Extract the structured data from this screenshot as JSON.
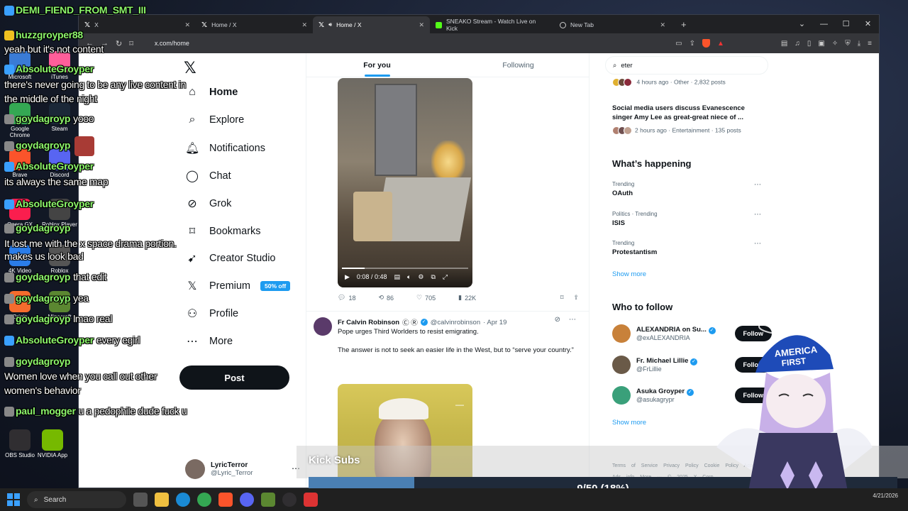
{
  "desktop": {
    "icons": [
      {
        "label": "Microsoft",
        "color": "#3a7bd5"
      },
      {
        "label": "iTunes",
        "color": "#ff5e9a"
      },
      {
        "label": "Google Chrome",
        "color": "#34a853"
      },
      {
        "label": "Steam",
        "color": "#1b2838"
      },
      {
        "label": "Brave",
        "color": "#fb542b"
      },
      {
        "label": "Discord",
        "color": "#5865f2"
      },
      {
        "label": "Opera GX",
        "color": "#fa1e4e"
      },
      {
        "label": "Roblox Player",
        "color": "#444"
      },
      {
        "label": "4K Video",
        "color": "#2b7de9"
      },
      {
        "label": "Roblox",
        "color": "#555"
      },
      {
        "label": "Origin",
        "color": "#f56c2d"
      },
      {
        "label": "Minecraft",
        "color": "#5b8731"
      },
      {
        "label": "OBS Studio",
        "color": "#302e31"
      },
      {
        "label": "NVIDIA App",
        "color": "#76b900"
      }
    ]
  },
  "browser": {
    "tabs": [
      {
        "label": "X",
        "active": false
      },
      {
        "label": "Home / X",
        "active": false
      },
      {
        "label": "Home / X",
        "active": true
      },
      {
        "label": "SNEAKO Stream - Watch Live on Kick",
        "active": false
      },
      {
        "label": "New Tab",
        "active": false
      }
    ],
    "url": "x.com/home"
  },
  "x": {
    "nav": [
      {
        "label": "Home",
        "icon": "home-icon",
        "glyph": "⌂",
        "bold": true
      },
      {
        "label": "Explore",
        "icon": "search-icon",
        "glyph": "⌕"
      },
      {
        "label": "Notifications",
        "icon": "bell-icon",
        "glyph": "🔔︎"
      },
      {
        "label": "Chat",
        "icon": "chat-icon",
        "glyph": "◯"
      },
      {
        "label": "Grok",
        "icon": "grok-icon",
        "glyph": "⊘"
      },
      {
        "label": "Bookmarks",
        "icon": "bookmark-icon",
        "glyph": "⌑"
      },
      {
        "label": "Creator Studio",
        "icon": "rocket-icon",
        "glyph": "➹"
      },
      {
        "label": "Premium",
        "icon": "x-premium-icon",
        "glyph": "𝕏",
        "badge": "50% off"
      },
      {
        "label": "Profile",
        "icon": "profile-icon",
        "glyph": "⚇"
      },
      {
        "label": "More",
        "icon": "more-icon",
        "glyph": "⋯"
      }
    ],
    "post_label": "Post",
    "me": {
      "name": "LyricTerror",
      "handle": "@Lyric_Terror"
    },
    "feed_tabs": [
      "For you",
      "Following"
    ],
    "tweet1": {
      "video_time": "0:08 / 0:48",
      "progress": 0.18,
      "replies": "18",
      "reposts": "86",
      "likes": "705",
      "views": "22K"
    },
    "tweet2": {
      "name": "Fr Calvin Robinson",
      "name_suffix": "Ⓒ Ⓡ",
      "handle": "@calvinrobinson",
      "date": "· Apr 19",
      "line1": "Pope urges Third Worlders to resist emigrating.",
      "line2": "The answer is not to seek an easier life in the West, but to “serve your country.”"
    },
    "search_value": "eter",
    "news": [
      {
        "meta": "4 hours ago · Other · 2,832 posts"
      },
      {
        "title": "Social media users discuss Evanescence singer Amy Lee as great-great niece of ...",
        "meta": "2 hours ago · Entertainment · 135 posts"
      }
    ],
    "whats_happening": "What’s happening",
    "trends": [
      {
        "ctx": "Trending",
        "name": "OAuth"
      },
      {
        "ctx": "Politics · Trending",
        "name": "ISIS"
      },
      {
        "ctx": "Trending",
        "name": "Protestantism"
      }
    ],
    "show_more": "Show more",
    "who_to_follow": "Who to follow",
    "follow_suggestions": [
      {
        "name": "ALEXANDRIA on Su...",
        "handle": "@exALEXANDRIA",
        "color": "#c8813a"
      },
      {
        "name": "Fr. Michael Lillie",
        "handle": "@FrLillie",
        "color": "#6a5a48"
      },
      {
        "name": "Asuka Groyper",
        "handle": "@asukagrypr",
        "color": "#3aa07a"
      }
    ],
    "follow_label": "Follow",
    "footer": "Terms of Service Privacy Policy Cookie Policy Accessibility Ads info More ··· © 2025 X Corp."
  },
  "chat": [
    {
      "user": "DEMI_FIEND_FROM_SMT_III",
      "msg": "",
      "badge": "#3aa0ff"
    },
    {
      "user": "huzzgroyper88",
      "msg": "",
      "badge": "#f0c020"
    },
    {
      "user": "",
      "msg": "yeah but it's not content"
    },
    {
      "user": "AbsoluteGroyper",
      "msg": "",
      "badge": "#3aa0ff"
    },
    {
      "user": "",
      "msg": "there's never going to be any live content in"
    },
    {
      "user": "",
      "msg": "the middle of the night"
    },
    {
      "user": "goydagroyp",
      "msg": "yooo",
      "badge": "#888"
    },
    {
      "user": "goydagroyp",
      "msg": "",
      "badge": "#888",
      "emote": true
    },
    {
      "user": "AbsoluteGroyper",
      "msg": "",
      "badge": "#3aa0ff"
    },
    {
      "user": "",
      "msg": "its always the same map"
    },
    {
      "user": "AbsoluteGroyper",
      "msg": "",
      "badge": "#3aa0ff"
    },
    {
      "user": "goydagroyp",
      "msg": "",
      "badge": "#888"
    },
    {
      "user": "",
      "msg": "It lost me with the x space drama portion."
    },
    {
      "user": "",
      "msg": "makes us look bad"
    },
    {
      "user": "goydagroyp",
      "msg": "that edit",
      "badge": "#888"
    },
    {
      "user": "goydagroyp",
      "msg": "yea",
      "badge": "#888"
    },
    {
      "user": "goydagroyp",
      "msg": "lmao real",
      "badge": "#888"
    },
    {
      "user": "AbsoluteGroyper",
      "msg": "every egirl",
      "badge": "#3aa0ff"
    },
    {
      "user": "goydagroyp",
      "msg": "",
      "badge": "#888"
    },
    {
      "user": "",
      "msg": "Women love when you call out other"
    },
    {
      "user": "",
      "msg": "women's behavior"
    },
    {
      "user": "paul_mogger",
      "msg": "u a pedophile dude fuck u",
      "badge": "#888"
    }
  ],
  "kick_subs": {
    "title": "Kick Subs",
    "label": "9/50 (18%)",
    "progress": 0.18
  },
  "taskbar": {
    "search": "Search",
    "date": "4/21/2026"
  }
}
